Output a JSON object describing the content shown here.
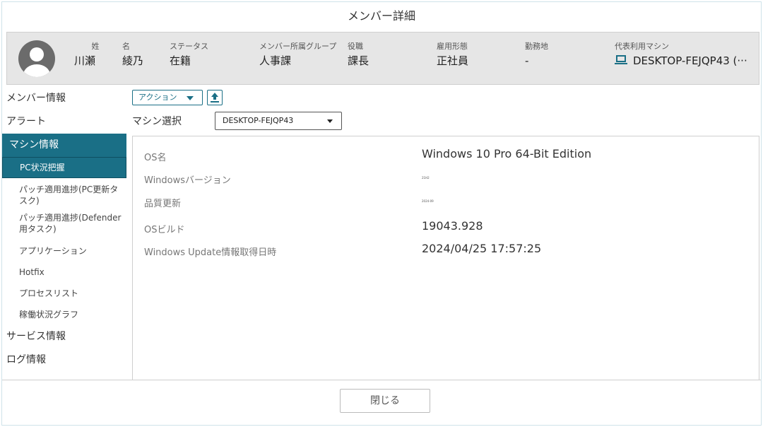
{
  "title": "メンバー詳細",
  "member": {
    "avatar_icon": "user-avatar-icon",
    "fields": [
      {
        "label": "姓",
        "value": "川瀬"
      },
      {
        "label": "名",
        "value": "綾乃"
      },
      {
        "label": "ステータス",
        "value": "在籍"
      },
      {
        "label": "メンバー所属グループ",
        "value": "人事課"
      },
      {
        "label": "役職",
        "value": "課長"
      },
      {
        "label": "雇用形態",
        "value": "正社員"
      },
      {
        "label": "勤務地",
        "value": "-"
      },
      {
        "label": "代表利用マシン",
        "value": "DESKTOP-FEJQP43 (···"
      }
    ]
  },
  "sidebar": {
    "items": [
      {
        "label": "メンバー情報"
      },
      {
        "label": "アラート"
      },
      {
        "label": "マシン情報"
      },
      {
        "label": "サービス情報"
      },
      {
        "label": "ログ情報"
      }
    ],
    "sub_items": [
      {
        "label": "PC状況把握"
      },
      {
        "label": "パッチ適用進捗(PC更新タスク)"
      },
      {
        "label": "パッチ適用進捗(Defender用タスク)"
      },
      {
        "label": "アプリケーション"
      },
      {
        "label": "Hotfix"
      },
      {
        "label": "プロセスリスト"
      },
      {
        "label": "稼働状況グラフ"
      }
    ]
  },
  "toolbar": {
    "action_label": "アクション",
    "machine_select_label": "マシン選択",
    "machine_select_value": "DESKTOP-FEJQP43"
  },
  "details": [
    {
      "key": "OS名",
      "value": "Windows 10 Pro 64-Bit Edition"
    },
    {
      "key": "Windowsバージョン",
      "value": "21H2"
    },
    {
      "key": "品質更新",
      "value": "2024-09"
    },
    {
      "key": "OSビルド",
      "value": "19043.928"
    },
    {
      "key": "Windows Update情報取得日時",
      "value": "2024/04/25 17:57:25"
    }
  ],
  "footer": {
    "close_label": "閉じる"
  },
  "colors": {
    "accent": "#1a6f86",
    "header_bg": "#e6e6e6",
    "border": "#cfcfcf"
  }
}
